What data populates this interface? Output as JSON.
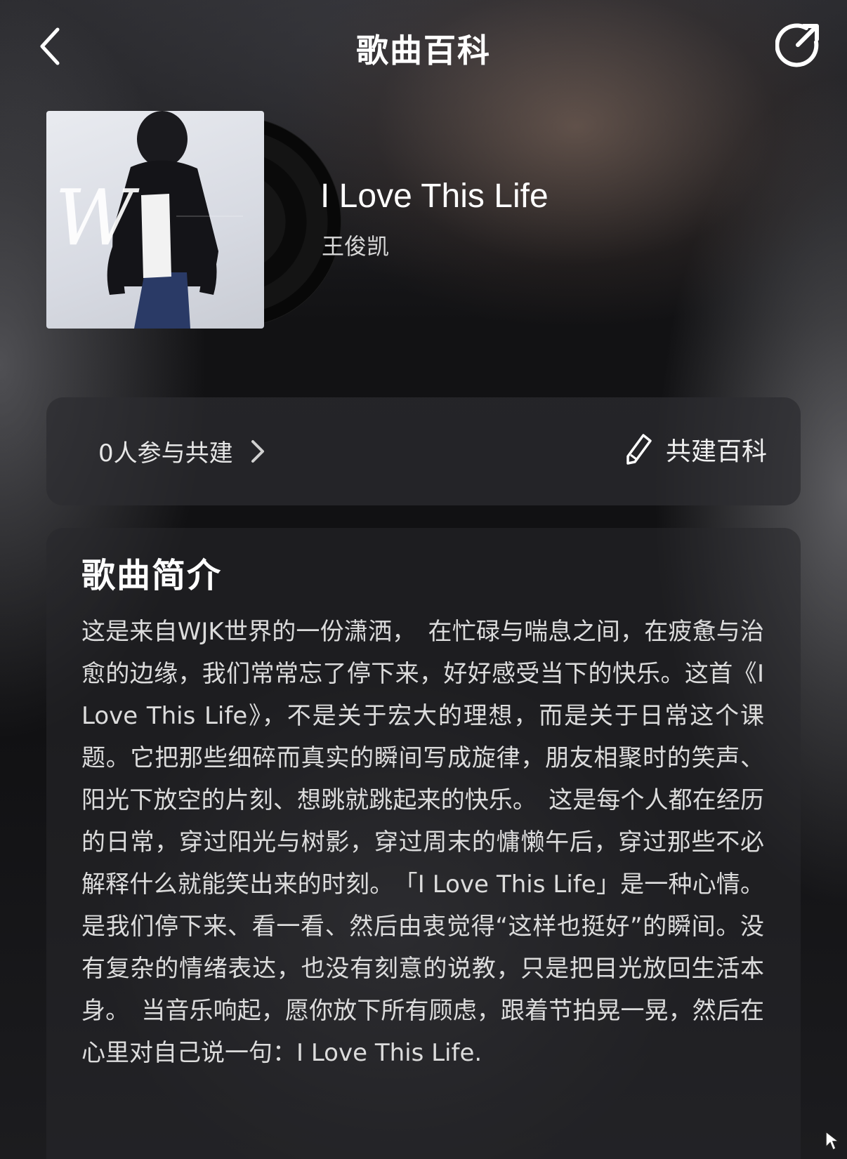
{
  "header": {
    "title": "歌曲百科",
    "back_icon": "chevron-left-icon",
    "share_icon": "share-arrow-icon"
  },
  "song": {
    "title": "I Love This Life",
    "artist": "王俊凯",
    "cover_script_text": "W"
  },
  "cobuild": {
    "participants_label": "0人参与共建",
    "action_label": "共建百科"
  },
  "intro": {
    "heading": "歌曲简介",
    "body": "这是来自WJK世界的一份潇洒，　在忙碌与喘息之间，在疲惫与治愈的边缘，我们常常忘了停下来，好好感受当下的快乐。这首《I Love This Life》，不是关于宏大的理想，而是关于日常这个课题。它把那些细碎而真实的瞬间写成旋律，朋友相聚时的笑声、阳光下放空的片刻、想跳就跳起来的快乐。　这是每个人都在经历的日常，穿过阳光与树影，穿过周末的慵懒午后，穿过那些不必解释什么就能笑出来的时刻。　「I Love This Life」是一种心情。是我们停下来、看一看、然后由衷觉得“这样也挺好”的瞬间。没有复杂的情绪表达，也没有刻意的说教，只是把目光放回生活本身。　当音乐响起，愿你放下所有顾虑，跟着节拍晃一晃，然后在心里对自己说一句：I Love This Life."
  },
  "colors": {
    "background": "#0f0f11",
    "card": "#2c2c30",
    "text_primary": "#ffffff",
    "text_body": "#dcdcdc"
  }
}
